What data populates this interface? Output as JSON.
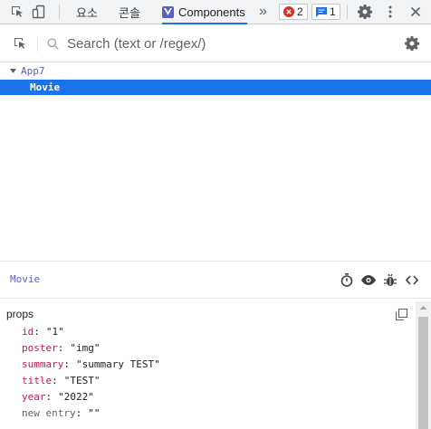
{
  "tabbar": {
    "tabs": [
      {
        "label": "요소"
      },
      {
        "label": "콘솔"
      },
      {
        "label": "Components"
      }
    ],
    "more_label": "»",
    "errors_count": "2",
    "messages_count": "1"
  },
  "toolbar": {
    "search_placeholder": "Search (text or /regex/)"
  },
  "tree": {
    "root_label": "App7",
    "selected_label": "Movie"
  },
  "inspector": {
    "component_name": "Movie",
    "section_title": "props",
    "props": [
      {
        "key": "id",
        "value": "\"1\""
      },
      {
        "key": "poster",
        "value": "\"img\""
      },
      {
        "key": "summary",
        "value": "\"summary TEST\""
      },
      {
        "key": "title",
        "value": "\"TEST\""
      },
      {
        "key": "year",
        "value": "\"2022\""
      },
      {
        "key": "new entry",
        "value": "\"\""
      }
    ]
  },
  "colors": {
    "accent": "#1a73e8",
    "vue_purple": "#5a5fc8",
    "prop_key": "#c2185b",
    "error_red": "#d93025"
  }
}
